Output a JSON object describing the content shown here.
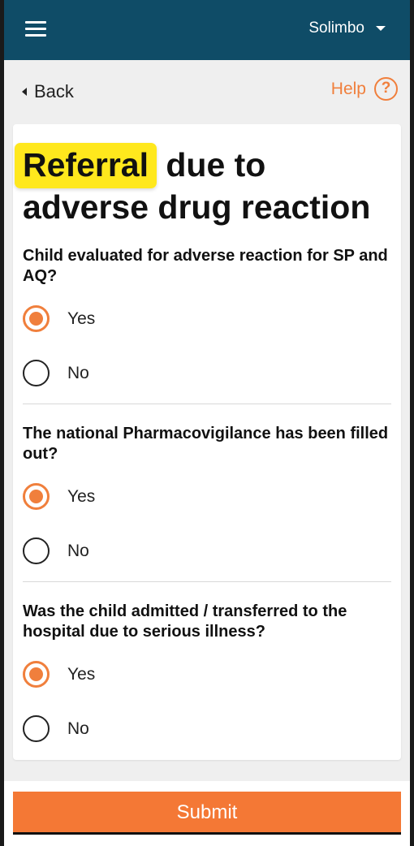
{
  "header": {
    "user_name": "Solimbo",
    "bg_color": "#0f4c67"
  },
  "nav": {
    "back_label": "Back",
    "help_label": "Help",
    "help_icon_glyph": "?"
  },
  "page": {
    "title_highlight": "Referral",
    "title_rest": " due to adverse drug reaction"
  },
  "questions": [
    {
      "text": "Child evaluated for adverse reaction for SP and AQ?",
      "options": [
        "Yes",
        "No"
      ],
      "selected": "Yes"
    },
    {
      "text": "The national Pharmacovigilance has been filled out?",
      "options": [
        "Yes",
        "No"
      ],
      "selected": "Yes"
    },
    {
      "text": "Was the child admitted / transferred to the hospital due to serious illness?",
      "options": [
        "Yes",
        "No"
      ],
      "selected": "Yes"
    }
  ],
  "footer": {
    "submit_label": "Submit"
  },
  "colors": {
    "accent": "#f07f3c",
    "highlight": "#ffe81d",
    "header": "#0f4c67"
  }
}
